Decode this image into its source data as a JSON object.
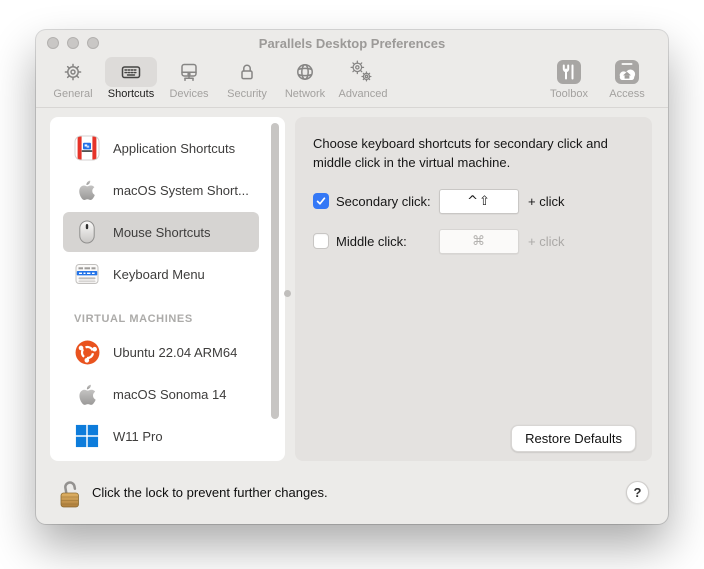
{
  "window": {
    "title": "Parallels Desktop Preferences"
  },
  "toolbar": {
    "tabs": [
      {
        "label": "General"
      },
      {
        "label": "Shortcuts"
      },
      {
        "label": "Devices"
      },
      {
        "label": "Security"
      },
      {
        "label": "Network"
      },
      {
        "label": "Advanced"
      }
    ],
    "right_tabs": [
      {
        "label": "Toolbox"
      },
      {
        "label": "Access"
      }
    ]
  },
  "sidebar": {
    "items": [
      {
        "label": "Application Shortcuts"
      },
      {
        "label": "macOS System Short..."
      },
      {
        "label": "Mouse Shortcuts"
      },
      {
        "label": "Keyboard Menu"
      }
    ],
    "section_header": "VIRTUAL MACHINES",
    "vms": [
      {
        "label": "Ubuntu 22.04 ARM64"
      },
      {
        "label": "macOS Sonoma 14"
      },
      {
        "label": "W11 Pro"
      }
    ]
  },
  "content": {
    "description": "Choose keyboard shortcuts for secondary click and middle click in the virtual machine.",
    "secondary": {
      "label": "Secondary click:",
      "shortcut": "^⇧",
      "suffix": "+ click",
      "checked": true
    },
    "middle": {
      "label": "Middle click:",
      "shortcut": "⌘",
      "suffix": "+ click",
      "checked": false
    },
    "restore_button_label": "Restore Defaults"
  },
  "footer": {
    "lock_text": "Click the lock to prevent further changes.",
    "help_label": "?"
  },
  "colors": {
    "accent_blue": "#3478F6",
    "ubuntu_orange": "#E9531F",
    "windows_blue": "#0D7CDB",
    "parallels_red": "#E63329",
    "parallels_screen_blue": "#2070E8",
    "selected_row_gray": "#D6D4D2"
  }
}
